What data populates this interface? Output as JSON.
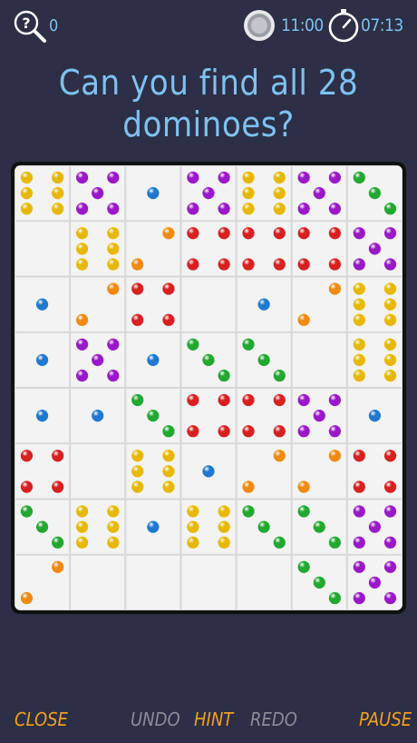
{
  "header": {
    "hint_count": "0",
    "best_time": "11:00",
    "elapsed_time": "07:13",
    "colors": {
      "accent": "#7fc1f0",
      "background": "#2c2f45"
    }
  },
  "title": "Can you find all 28 dominoes?",
  "board": {
    "rows": 8,
    "cols": 7,
    "cells": [
      [
        6,
        5,
        1,
        5,
        6,
        5,
        3
      ],
      [
        0,
        6,
        2,
        4,
        4,
        4,
        5
      ],
      [
        1,
        2,
        4,
        0,
        1,
        2,
        6
      ],
      [
        1,
        5,
        1,
        3,
        3,
        0,
        6
      ],
      [
        1,
        1,
        3,
        4,
        4,
        5,
        1
      ],
      [
        4,
        0,
        6,
        1,
        2,
        2,
        4
      ],
      [
        3,
        6,
        1,
        6,
        3,
        3,
        5
      ],
      [
        2,
        0,
        0,
        0,
        0,
        3,
        5
      ]
    ],
    "pip_colors": {
      "1": "#1f78d0",
      "2": "#f08a10",
      "3": "#22a830",
      "4": "#d82020",
      "5": "#9a18c8",
      "6": "#e8b800"
    }
  },
  "footer": {
    "close_label": "CLOSE",
    "undo_label": "UNDO",
    "hint_label": "HINT",
    "redo_label": "REDO",
    "pause_label": "PAUSE"
  },
  "icons": [
    "search-hint-icon",
    "coin-icon",
    "stopwatch-icon"
  ]
}
